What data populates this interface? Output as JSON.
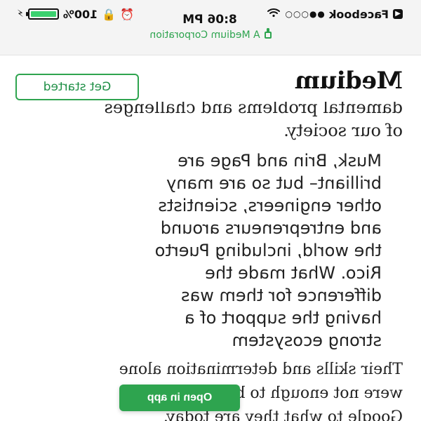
{
  "status_bar": {
    "back_app": "Facebook",
    "signal": "●●○○○",
    "time": "8:06 PM",
    "battery_percent_text": "100%",
    "battery_level": 1.0,
    "url_text": "A Medium Corporation"
  },
  "header": {
    "logo_text": "Medium",
    "get_started_label": "Get started"
  },
  "article": {
    "top_paragraph": "damental problems and challenges\nof our society.",
    "quote": "Musk, Brin and Page are\nbrilliant– but so are many\nother engineers, scientists\nand entrepreneurs around\nthe world, including Puerto\nRico. What made the\ndifference for them was\nhaving the support of a\nstrong ecosystem",
    "bottom_paragraph": "Their skills and determination alone\nwere not enough to build Tesla and\nGoogle to what they are today."
  },
  "cta": {
    "open_in_app_label": "Open in app"
  },
  "colors": {
    "accent_green": "#2ea44f",
    "battery_green": "#3bd16f"
  }
}
